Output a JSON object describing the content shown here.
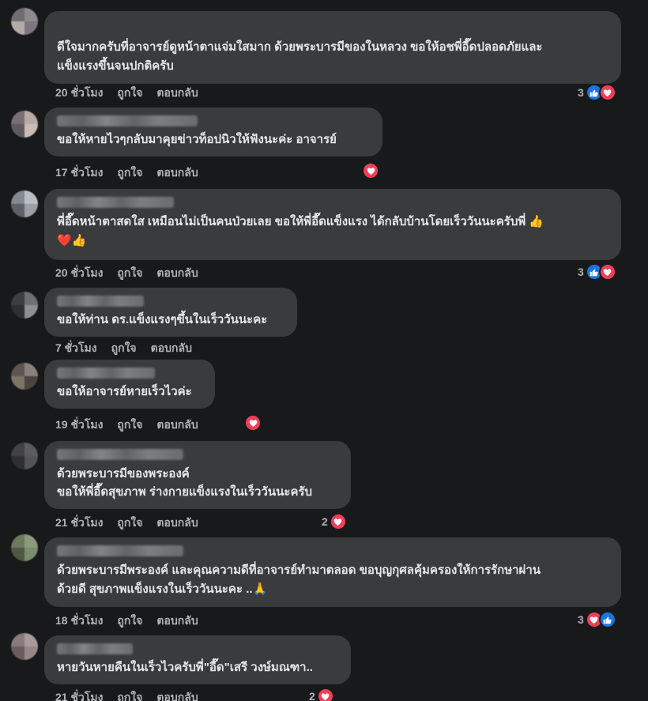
{
  "comments": [
    {
      "text": "ดีใจมากครับที่อาจารย์ดูหน้าตาแจ่มใสมาก ด้วยพระบารมีของในหลวง ขอให้อชพี่อี๊ดปลอดภัยและ\nแข็งแรงขึ้นจนปกติครับ",
      "time": "20 ชั่วโมง",
      "like": "ถูกใจ",
      "reply": "ตอบกลับ",
      "reaction_count": "3",
      "reactions": [
        "like",
        "love"
      ]
    },
    {
      "text": "ขอให้หายไวๆกลับมาคุยข่าวท็อปนิวให้ฟังนะค่ะ อาจารย์",
      "time": "17 ชั่วโมง",
      "like": "ถูกใจ",
      "reply": "ตอบกลับ",
      "reaction_count": "",
      "reactions": [
        "love"
      ]
    },
    {
      "text": "พี่อี๊ดหน้าตาสดใส เหมือนไม่เป็นคนป่วยเลย ขอให้พี่อี๊ดแข็งแรง ได้กลับบ้านโดยเร็ววันนะครับพี่",
      "emoji_end": "👍",
      "emoji_line2": "❤️👍",
      "time": "20 ชั่วโมง",
      "like": "ถูกใจ",
      "reply": "ตอบกลับ",
      "reaction_count": "3",
      "reactions": [
        "like",
        "love"
      ]
    },
    {
      "text": "ขอให้ท่าน ดร.แข็งแรงๆขึ้นในเร็ววันนะคะ",
      "time": "7 ชั่วโมง",
      "like": "ถูกใจ",
      "reply": "ตอบกลับ",
      "reaction_count": "",
      "reactions": []
    },
    {
      "text": "ขอให้อาจารย์หายเร็วไวค่ะ",
      "time": "19 ชั่วโมง",
      "like": "ถูกใจ",
      "reply": "ตอบกลับ",
      "reaction_count": "",
      "reactions": [
        "love"
      ]
    },
    {
      "text": "ด้วยพระบารมีของพระองค์\nขอให้พี่อี๊ดสุขภาพ ร่างกายแข็งแรงในเร็ววันนะครับ",
      "time": "21 ชั่วโมง",
      "like": "ถูกใจ",
      "reply": "ตอบกลับ",
      "reaction_count": "2",
      "reactions": [
        "love"
      ]
    },
    {
      "text": "ด้วยพระบารมีพระองค์ และคุณความดีที่อาจารย์ทำมาตลอด ขอบุญกุศลคุ้มครองให้การรักษาผ่าน\nด้วยดี สุขภาพแข็งแรงในเร็ววันนะคะ ..",
      "emoji_end": "🙏",
      "time": "18 ชั่วโมง",
      "like": "ถูกใจ",
      "reply": "ตอบกลับ",
      "reaction_count": "3",
      "reactions": [
        "love",
        "like"
      ]
    },
    {
      "text": "หายวันหายคืนในเร็วไวครับพี่\"อี๊ด\"เสรี วงษ์มณฑา..",
      "time": "21 ชั่วโมง",
      "like": "ถูกใจ",
      "reply": "ตอบกลับ",
      "reaction_count": "2",
      "reactions": [
        "love"
      ]
    }
  ],
  "colors": {
    "background": "#18191a",
    "bubble": "#3a3b3c",
    "text": "#e4e6eb",
    "muted": "#b0b3b8",
    "like": "#1b74e4",
    "love": "#f33e58"
  }
}
